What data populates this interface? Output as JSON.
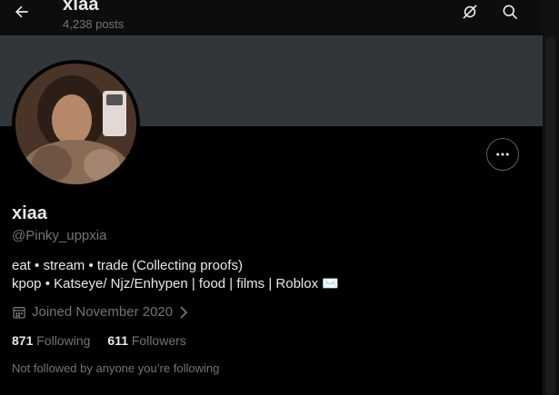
{
  "header": {
    "title": "xiaa",
    "posts_count": "4,238 posts",
    "back_icon": "arrow-left-icon",
    "hide_icon": "eye-slash-icon",
    "search_icon": "search-icon"
  },
  "profile": {
    "display_name": "xiaa",
    "handle": "@Pinky_uppxia",
    "bio_line_1": "eat • stream • trade (Collecting proofs)",
    "bio_line_2": "kpop • Katseye/ Njz/Enhypen | food | films | Roblox ✉️",
    "joined": "Joined November 2020",
    "following_count": "871",
    "following_label": "Following",
    "followers_count": "611",
    "followers_label": "Followers",
    "followed_note": "Not followed by anyone you’re following"
  },
  "colors": {
    "background": "#000000",
    "banner": "#333639",
    "primary_text": "#e7e9ea",
    "secondary_text": "#71767b",
    "border": "#536471"
  }
}
